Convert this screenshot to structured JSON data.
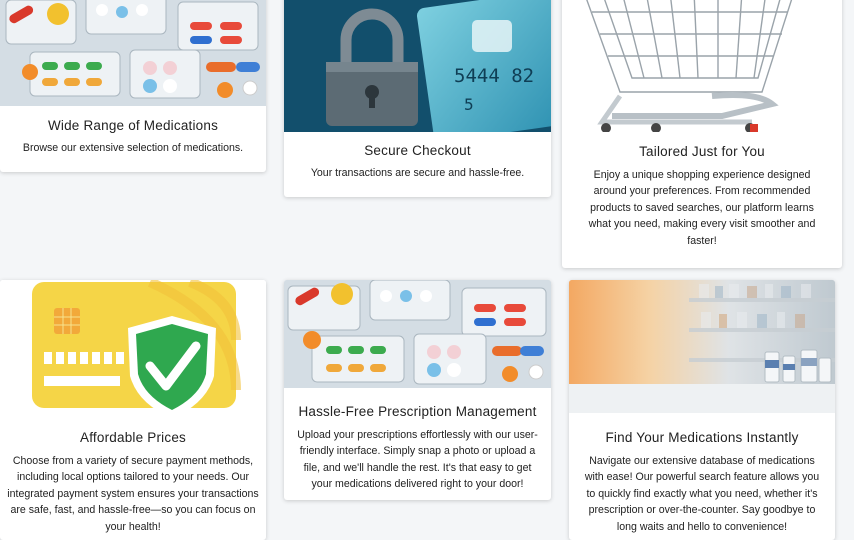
{
  "cards": [
    {
      "title": "Wide Range of Medications",
      "text": "Browse our extensive selection of medications.",
      "image": "pills-image"
    },
    {
      "title": "Secure Checkout",
      "text": "Your transactions are secure and hassle-free.",
      "image": "padlock-credit-card-image",
      "card_number_fragment": "5444 82",
      "card_number_fragment2": "5"
    },
    {
      "title": "Tailored Just for You",
      "text": "Enjoy a unique shopping experience designed around your preferences. From recommended products to saved searches, our platform learns what you need, making every visit smoother and faster!",
      "image": "shopping-cart-image"
    },
    {
      "title": "Affordable Prices",
      "text": "Choose from a variety of secure payment methods, including local options tailored to your needs. Our integrated payment system ensures your transactions are safe, fast, and hassle-free—so you can focus on your health!",
      "image": "card-shield-checkmark-image"
    },
    {
      "title": "Hassle-Free Prescription Management",
      "text": "Upload your prescriptions effortlessly with our user-friendly interface. Simply snap a photo or upload a file, and we'll handle the rest. It's that easy to get your medications delivered right to your door!",
      "image": "pills-image"
    },
    {
      "title": "Find Your Medications Instantly",
      "text": "Navigate our extensive database of medications with ease! Our powerful search feature allows you to quickly find exactly what you need, whether it's prescription or over-the-counter. Say goodbye to long waits and hello to convenience!",
      "image": "pharmacy-shelf-image"
    }
  ],
  "colors": {
    "page_bg": "#f4f6f8",
    "card_bg": "#ffffff",
    "shield_green": "#2fa84f",
    "card_yellow": "#f5d547"
  }
}
